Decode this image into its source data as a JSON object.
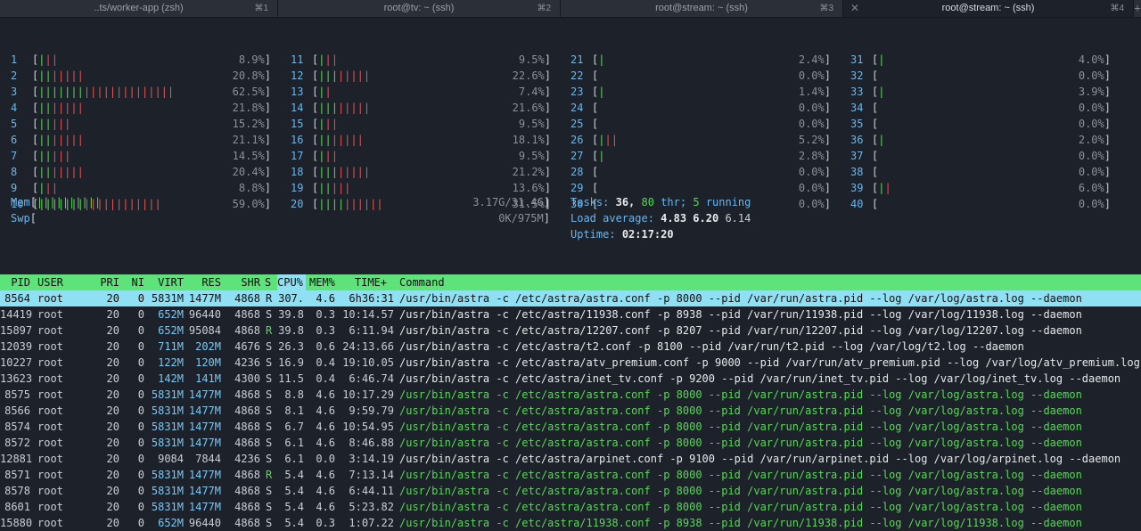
{
  "tabs": [
    {
      "title": "..ts/worker-app (zsh)",
      "shortcut": "⌘1"
    },
    {
      "title": "root@tv: ~ (ssh)",
      "shortcut": "⌘2"
    },
    {
      "title": "root@stream: ~ (ssh)",
      "shortcut": "⌘3"
    },
    {
      "title": "root@stream: ~ (ssh)",
      "shortcut": "⌘4",
      "active": true
    }
  ],
  "tab_close_glyph": "✕",
  "tab_plus_glyph": "+",
  "cpus": [
    [
      {
        "n": "1",
        "pct": "8.9%"
      },
      {
        "n": "2",
        "pct": "20.8%"
      },
      {
        "n": "3",
        "pct": "62.5%"
      },
      {
        "n": "4",
        "pct": "21.8%"
      },
      {
        "n": "5",
        "pct": "15.2%"
      },
      {
        "n": "6",
        "pct": "21.1%"
      },
      {
        "n": "7",
        "pct": "14.5%"
      },
      {
        "n": "8",
        "pct": "20.4%"
      },
      {
        "n": "9",
        "pct": "8.8%"
      },
      {
        "n": "10",
        "pct": "59.0%"
      }
    ],
    [
      {
        "n": "11",
        "pct": "9.5%"
      },
      {
        "n": "12",
        "pct": "22.6%"
      },
      {
        "n": "13",
        "pct": "7.4%"
      },
      {
        "n": "14",
        "pct": "21.6%"
      },
      {
        "n": "15",
        "pct": "9.5%"
      },
      {
        "n": "16",
        "pct": "18.1%"
      },
      {
        "n": "17",
        "pct": "9.5%"
      },
      {
        "n": "18",
        "pct": "21.2%"
      },
      {
        "n": "19",
        "pct": "13.6%"
      },
      {
        "n": "20",
        "pct": "31.5%"
      }
    ],
    [
      {
        "n": "21",
        "pct": "2.4%"
      },
      {
        "n": "22",
        "pct": "0.0%"
      },
      {
        "n": "23",
        "pct": "1.4%"
      },
      {
        "n": "24",
        "pct": "0.0%"
      },
      {
        "n": "25",
        "pct": "0.0%"
      },
      {
        "n": "26",
        "pct": "5.2%"
      },
      {
        "n": "27",
        "pct": "2.8%"
      },
      {
        "n": "28",
        "pct": "0.0%"
      },
      {
        "n": "29",
        "pct": "0.0%"
      },
      {
        "n": "30",
        "pct": "0.0%"
      }
    ],
    [
      {
        "n": "31",
        "pct": "4.0%"
      },
      {
        "n": "32",
        "pct": "0.0%"
      },
      {
        "n": "33",
        "pct": "3.9%"
      },
      {
        "n": "34",
        "pct": "0.0%"
      },
      {
        "n": "35",
        "pct": "0.0%"
      },
      {
        "n": "36",
        "pct": "2.0%"
      },
      {
        "n": "37",
        "pct": "0.0%"
      },
      {
        "n": "38",
        "pct": "0.0%"
      },
      {
        "n": "39",
        "pct": "6.0%"
      },
      {
        "n": "40",
        "pct": "0.0%"
      }
    ]
  ],
  "mem": {
    "label": "Mem",
    "value": "3.17G/31.4G"
  },
  "swp": {
    "label": "Swp",
    "value": "0K/975M"
  },
  "tasks": {
    "label": "Tasks:",
    "count": "36,",
    "threads": "80",
    "thr_label": "thr;",
    "running": "5",
    "running_label": "running"
  },
  "load": {
    "label": "Load average:",
    "v1": "4.83",
    "v5": "6.20",
    "v15": "6.14"
  },
  "uptime": {
    "label": "Uptime:",
    "value": "02:17:20"
  },
  "header": [
    "PID",
    "USER",
    "PRI",
    "NI",
    "VIRT",
    "RES",
    "SHR",
    "S",
    "CPU%",
    "MEM%",
    "TIME+",
    "Command"
  ],
  "processes": [
    {
      "pid": "8564",
      "user": "root",
      "pri": "20",
      "ni": "0",
      "virt": "5831M",
      "res": "1477M",
      "shr": "4868",
      "s": "R",
      "cpu": "307.",
      "mem": "4.6",
      "time": "6h36:31",
      "cmd": "/usr/bin/astra -c /etc/astra/astra.conf -p 8000 --pid /var/run/astra.pid --log /var/log/astra.log --daemon",
      "selected": true
    },
    {
      "pid": "14419",
      "user": "root",
      "pri": "20",
      "ni": "0",
      "virt": "652M",
      "res": "96440",
      "shr": "4868",
      "s": "S",
      "cpu": "39.8",
      "mem": "0.3",
      "time": "10:14.57",
      "cmd": "/usr/bin/astra -c /etc/astra/11938.conf -p 8938 --pid /var/run/11938.pid --log /var/log/11938.log --daemon"
    },
    {
      "pid": "15897",
      "user": "root",
      "pri": "20",
      "ni": "0",
      "virt": "652M",
      "res": "95084",
      "shr": "4868",
      "s": "R",
      "cpu": "39.8",
      "mem": "0.3",
      "time": "6:11.94",
      "cmd": "/usr/bin/astra -c /etc/astra/12207.conf -p 8207 --pid /var/run/12207.pid --log /var/log/12207.log --daemon"
    },
    {
      "pid": "12039",
      "user": "root",
      "pri": "20",
      "ni": "0",
      "virt": "711M",
      "res": "202M",
      "shr": "4676",
      "s": "S",
      "cpu": "26.3",
      "mem": "0.6",
      "time": "24:13.66",
      "cmd": "/usr/bin/astra -c /etc/astra/t2.conf -p 8100 --pid /var/run/t2.pid --log /var/log/t2.log --daemon"
    },
    {
      "pid": "10227",
      "user": "root",
      "pri": "20",
      "ni": "0",
      "virt": "122M",
      "res": "120M",
      "shr": "4236",
      "s": "S",
      "cpu": "16.9",
      "mem": "0.4",
      "time": "19:10.05",
      "cmd": "/usr/bin/astra -c /etc/astra/atv_premium.conf -p 9000 --pid /var/run/atv_premium.pid --log /var/log/atv_premium.log -"
    },
    {
      "pid": "13623",
      "user": "root",
      "pri": "20",
      "ni": "0",
      "virt": "142M",
      "res": "141M",
      "shr": "4300",
      "s": "S",
      "cpu": "11.5",
      "mem": "0.4",
      "time": "6:46.74",
      "cmd": "/usr/bin/astra -c /etc/astra/inet_tv.conf -p 9200 --pid /var/run/inet_tv.pid --log /var/log/inet_tv.log --daemon"
    },
    {
      "pid": "8575",
      "user": "root",
      "pri": "20",
      "ni": "0",
      "virt": "5831M",
      "res": "1477M",
      "shr": "4868",
      "s": "S",
      "cpu": "8.8",
      "mem": "4.6",
      "time": "10:17.29",
      "cmd": "/usr/bin/astra -c /etc/astra/astra.conf -p 8000 --pid /var/run/astra.pid --log /var/log/astra.log --daemon",
      "thread": true
    },
    {
      "pid": "8566",
      "user": "root",
      "pri": "20",
      "ni": "0",
      "virt": "5831M",
      "res": "1477M",
      "shr": "4868",
      "s": "S",
      "cpu": "8.1",
      "mem": "4.6",
      "time": "9:59.79",
      "cmd": "/usr/bin/astra -c /etc/astra/astra.conf -p 8000 --pid /var/run/astra.pid --log /var/log/astra.log --daemon",
      "thread": true
    },
    {
      "pid": "8574",
      "user": "root",
      "pri": "20",
      "ni": "0",
      "virt": "5831M",
      "res": "1477M",
      "shr": "4868",
      "s": "S",
      "cpu": "6.7",
      "mem": "4.6",
      "time": "10:54.95",
      "cmd": "/usr/bin/astra -c /etc/astra/astra.conf -p 8000 --pid /var/run/astra.pid --log /var/log/astra.log --daemon",
      "thread": true
    },
    {
      "pid": "8572",
      "user": "root",
      "pri": "20",
      "ni": "0",
      "virt": "5831M",
      "res": "1477M",
      "shr": "4868",
      "s": "S",
      "cpu": "6.1",
      "mem": "4.6",
      "time": "8:46.88",
      "cmd": "/usr/bin/astra -c /etc/astra/astra.conf -p 8000 --pid /var/run/astra.pid --log /var/log/astra.log --daemon",
      "thread": true
    },
    {
      "pid": "12881",
      "user": "root",
      "pri": "20",
      "ni": "0",
      "virt": "9084",
      "res": "7844",
      "shr": "4236",
      "s": "S",
      "cpu": "6.1",
      "mem": "0.0",
      "time": "3:14.19",
      "cmd": "/usr/bin/astra -c /etc/astra/arpinet.conf -p 9100 --pid /var/run/arpinet.pid --log /var/log/arpinet.log --daemon"
    },
    {
      "pid": "8571",
      "user": "root",
      "pri": "20",
      "ni": "0",
      "virt": "5831M",
      "res": "1477M",
      "shr": "4868",
      "s": "R",
      "cpu": "5.4",
      "mem": "4.6",
      "time": "7:13.14",
      "cmd": "/usr/bin/astra -c /etc/astra/astra.conf -p 8000 --pid /var/run/astra.pid --log /var/log/astra.log --daemon",
      "thread": true
    },
    {
      "pid": "8578",
      "user": "root",
      "pri": "20",
      "ni": "0",
      "virt": "5831M",
      "res": "1477M",
      "shr": "4868",
      "s": "S",
      "cpu": "5.4",
      "mem": "4.6",
      "time": "6:44.11",
      "cmd": "/usr/bin/astra -c /etc/astra/astra.conf -p 8000 --pid /var/run/astra.pid --log /var/log/astra.log --daemon",
      "thread": true
    },
    {
      "pid": "8601",
      "user": "root",
      "pri": "20",
      "ni": "0",
      "virt": "5831M",
      "res": "1477M",
      "shr": "4868",
      "s": "S",
      "cpu": "5.4",
      "mem": "4.6",
      "time": "5:23.82",
      "cmd": "/usr/bin/astra -c /etc/astra/astra.conf -p 8000 --pid /var/run/astra.pid --log /var/log/astra.log --daemon",
      "thread": true
    },
    {
      "pid": "15880",
      "user": "root",
      "pri": "20",
      "ni": "0",
      "virt": "652M",
      "res": "96440",
      "shr": "4868",
      "s": "S",
      "cpu": "5.4",
      "mem": "0.3",
      "time": "1:07.22",
      "cmd": "/usr/bin/astra -c /etc/astra/11938.conf -p 8938 --pid /var/run/11938.pid --log /var/log/11938.log --daemon",
      "thread": true
    }
  ]
}
